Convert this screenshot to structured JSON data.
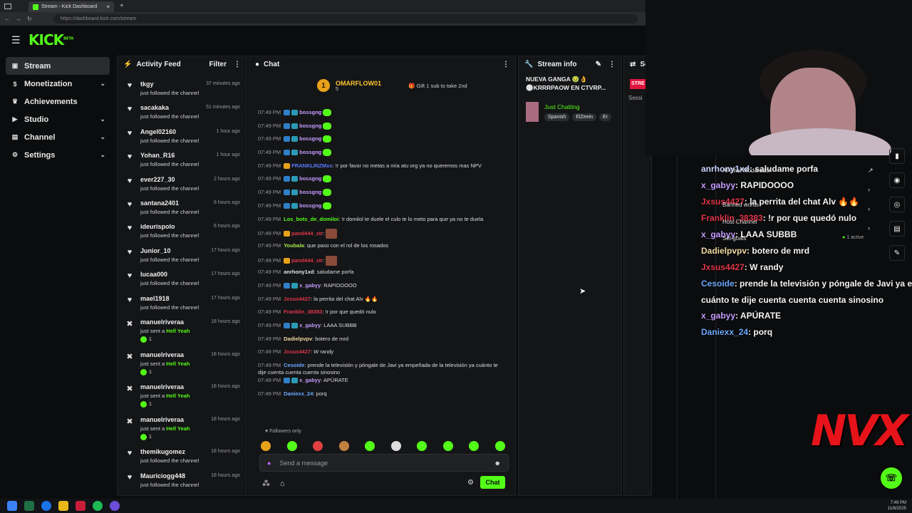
{
  "browser": {
    "tab_title": "Stream - Kick Dashboard",
    "url": "https://dashboard.kick.com/stream"
  },
  "brand": {
    "logo": "KICK",
    "beta": "BETA",
    "accent": "#53fc18"
  },
  "sidebar": {
    "items": [
      {
        "label": "Stream",
        "icon": "broadcast-icon",
        "active": true
      },
      {
        "label": "Monetization",
        "icon": "dollar-icon",
        "chevron": true
      },
      {
        "label": "Achievements",
        "icon": "trophy-icon"
      },
      {
        "label": "Studio",
        "icon": "video-icon",
        "chevron": true
      },
      {
        "label": "Channel",
        "icon": "channel-icon",
        "chevron": true
      },
      {
        "label": "Settings",
        "icon": "gear-icon",
        "chevron": true
      }
    ]
  },
  "activity": {
    "title": "Activity Feed",
    "filter": "Filter",
    "items": [
      {
        "name": "tkgy",
        "desc": "just followed the channel",
        "time": "37 minutes ago",
        "type": "follow"
      },
      {
        "name": "sacakaka",
        "desc": "just followed the channel",
        "time": "51 minutes ago",
        "type": "follow"
      },
      {
        "name": "Angel02160",
        "desc": "just followed the channel",
        "time": "1 hour ago",
        "type": "follow"
      },
      {
        "name": "Yohan_R16",
        "desc": "just followed the channel",
        "time": "1 hour ago",
        "type": "follow"
      },
      {
        "name": "ever227_30",
        "desc": "just followed the channel",
        "time": "2 hours ago",
        "type": "follow"
      },
      {
        "name": "santana2401",
        "desc": "just followed the channel",
        "time": "6 hours ago",
        "type": "follow"
      },
      {
        "name": "ideurispolo",
        "desc": "just followed the channel",
        "time": "6 hours ago",
        "type": "follow"
      },
      {
        "name": "Junior_10",
        "desc": "just followed the channel",
        "time": "17 hours ago",
        "type": "follow"
      },
      {
        "name": "lucaa000",
        "desc": "just followed the channel",
        "time": "17 hours ago",
        "type": "follow"
      },
      {
        "name": "mael1918",
        "desc": "just followed the channel",
        "time": "17 hours ago",
        "type": "follow"
      },
      {
        "name": "manuelriveraa",
        "desc": "just sent a",
        "gift": "Hell Yeah",
        "time": "18 hours ago",
        "type": "kicks",
        "amount": "1"
      },
      {
        "name": "manuelriveraa",
        "desc": "just sent a",
        "gift": "Hell Yeah",
        "time": "18 hours ago",
        "type": "kicks",
        "amount": "1"
      },
      {
        "name": "manuelriveraa",
        "desc": "just sent a",
        "gift": "Hell Yeah",
        "time": "18 hours ago",
        "type": "kicks",
        "amount": "1"
      },
      {
        "name": "manuelriveraa",
        "desc": "just sent a",
        "gift": "Hell Yeah",
        "time": "18 hours ago",
        "type": "kicks",
        "amount": "1"
      },
      {
        "name": "themikugomez",
        "desc": "just followed the channel",
        "time": "18 hours ago",
        "type": "follow"
      },
      {
        "name": "Mauriciogg448",
        "desc": "just followed the channel",
        "time": "18 hours ago",
        "type": "follow"
      }
    ]
  },
  "chat": {
    "title": "Chat",
    "pinned": {
      "rank": "1",
      "name": "OMARFLOW01",
      "count": "5",
      "gift_text": "Gift 1 sub to take 2nd"
    },
    "messages": [
      {
        "time": "07:49 PM",
        "user": "bossgng",
        "color": "#c49bff",
        "text": "",
        "emote": true
      },
      {
        "time": "07:49 PM",
        "user": "bossgng",
        "color": "#c49bff",
        "text": "",
        "emote": true
      },
      {
        "time": "07:49 PM",
        "user": "bossgng",
        "color": "#c49bff",
        "text": "",
        "emote": true
      },
      {
        "time": "07:49 PM",
        "user": "bossgng",
        "color": "#c49bff",
        "text": "",
        "emote": true
      },
      {
        "time": "07:49 PM",
        "user": "FRANKLINZMxx",
        "color": "#5a7bff",
        "text": ": !r por favor no metas a mía atu org ya no queremos mas NPV"
      },
      {
        "time": "07:49 PM",
        "user": "bossgng",
        "color": "#c49bff",
        "text": "",
        "emote": true
      },
      {
        "time": "07:49 PM",
        "user": "bossgng",
        "color": "#c49bff",
        "text": "",
        "emote": true
      },
      {
        "time": "07:49 PM",
        "user": "bossgng",
        "color": "#c49bff",
        "text": "",
        "emote": true
      },
      {
        "time": "07:49 PM",
        "user": "Los_bots_de_domiloi",
        "color": "#53fc18",
        "text": ": !r domilol te duele el culo te lo meto para que ya no te duela"
      },
      {
        "time": "07:49 PM",
        "user": "pand444_str",
        "color": "#e0364a",
        "text": ":"
      },
      {
        "time": "07:49 PM",
        "user": "Youbala",
        "color": "#a5e84a",
        "text": ": que paso con el rol de los rosados"
      },
      {
        "time": "07:49 PM",
        "user": "pand444_str",
        "color": "#e0364a",
        "text": ":"
      },
      {
        "time": "07:49 PM",
        "user": "anrhony1xd",
        "color": "#e6e6e6",
        "text": ": saludame porfa"
      },
      {
        "time": "07:49 PM",
        "user": "x_gabyy",
        "color": "#c49bff",
        "text": ": RAPIDOOOO"
      },
      {
        "time": "07:49 PM",
        "user": "Jxsus4427",
        "color": "#e0364a",
        "text": ": la perrita del chat Alv 🔥🔥"
      },
      {
        "time": "07:49 PM",
        "user": "Franklin_38383",
        "color": "#e0364a",
        "text": ": !r por que quedó nulo"
      },
      {
        "time": "07:49 PM",
        "user": "x_gabyy",
        "color": "#c49bff",
        "text": ": LAAA SUBBB"
      },
      {
        "time": "07:49 PM",
        "user": "Dadielpvpv",
        "color": "#f0d9a0",
        "text": ": botero de mrd"
      },
      {
        "time": "07:49 PM",
        "user": "Jxsus4427",
        "color": "#e0364a",
        "text": ": W randy"
      },
      {
        "time": "07:49 PM",
        "user": "Cesoide",
        "color": "#6aa8ff",
        "text": ": prende la televisión y póngale de Javi ya empeñada de la televisión ya cuánto te dije cuenta cuenta cuenta sinosino"
      },
      {
        "time": "07:49 PM",
        "user": "x_gabyy",
        "color": "#c49bff",
        "text": ": APÚRATE"
      },
      {
        "time": "07:49 PM",
        "user": "Daniexx_24",
        "color": "#6aa8ff",
        "text": ": porq"
      }
    ],
    "followers_only": "Followers only",
    "placeholder": "Send a message",
    "send": "Chat"
  },
  "stream_info": {
    "title": "Stream info",
    "stream_title": "NUEVA GANGA 🤢👌 ⚪KRRRPAOW EN CTVRP...",
    "category": "Just Chatting",
    "tags": [
      "Spanish",
      "ElZeein",
      "Er"
    ]
  },
  "session": {
    "title": "Se",
    "badge": "STRE",
    "sub": "Sessi"
  },
  "overlay": {
    "lines": [
      {
        "user": "anrhony1xd",
        "text": " : saludame porfa",
        "color": "#c9d4ff"
      },
      {
        "user": "x_gabyy",
        "text": " : RAPIDOOOO",
        "color": "#c49bff"
      },
      {
        "user": "Jxsus4427",
        "text": " : la perrita del chat Alv 🔥🔥",
        "color": "#e0364a"
      },
      {
        "user": "Franklin_38383",
        "text": " : !r por que quedó nulo",
        "color": "#e0364a"
      },
      {
        "user": "x_gabyy",
        "text": " : LAAA SUBBB",
        "color": "#c49bff"
      },
      {
        "user": "Dadielpvpv",
        "text": " : botero de mrd",
        "color": "#f0d9a0"
      },
      {
        "user": "Jxsus4427",
        "text": " : W randy",
        "color": "#e0364a"
      },
      {
        "user": "Cesoide",
        "text": " : prende la televisión y póngale de Javi ya en",
        "color": "#6aa8ff"
      },
      {
        "user": "",
        "text": "cuánto te dije cuenta cuenta cuenta sinosino",
        "color": "#ffffff"
      },
      {
        "user": "x_gabyy",
        "text": " : APÚRATE",
        "color": "#c49bff"
      },
      {
        "user": "Daniexx_24",
        "text": " : porq",
        "color": "#6aa8ff"
      }
    ],
    "menu": [
      "AI Chat Moderation",
      "Banned words",
      "Host Channel",
      "Set goals"
    ],
    "active": "1 active",
    "watermark": "NVX"
  },
  "taskbar": {
    "time": "7:49 PM",
    "date": "11/8/2025"
  }
}
